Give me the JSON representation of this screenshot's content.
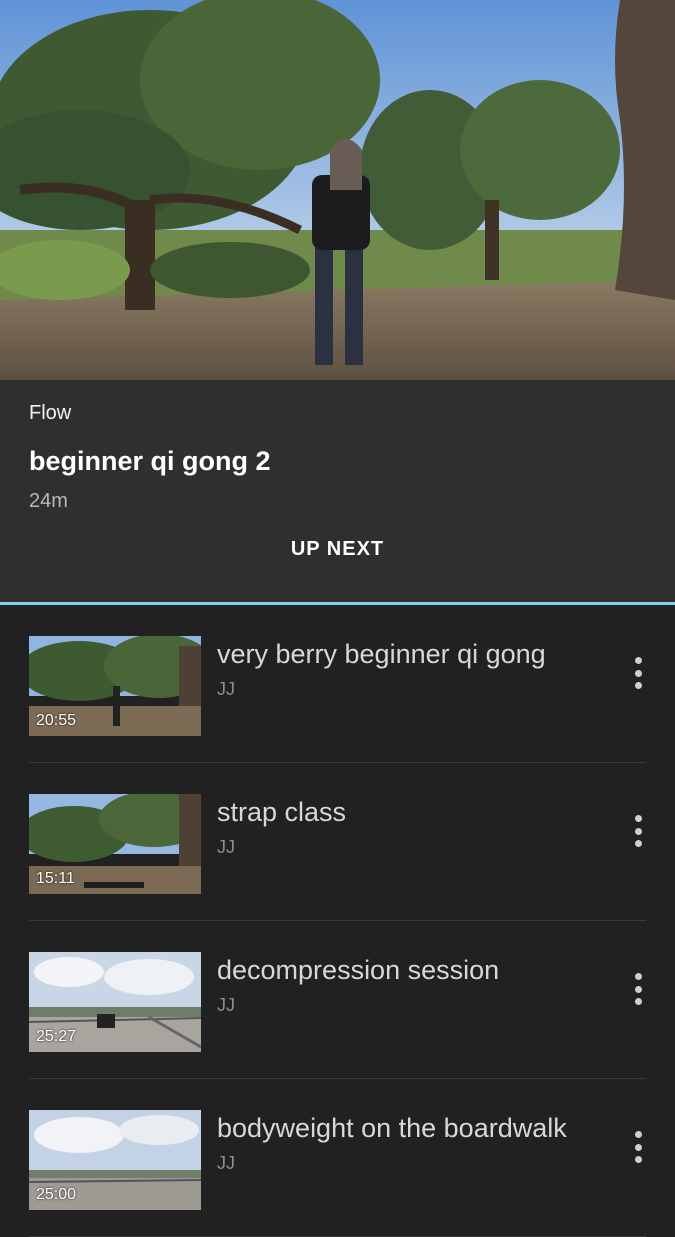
{
  "video": {
    "category": "Flow",
    "title": "beginner qi gong 2",
    "duration": "24m"
  },
  "tabs": {
    "up_next_label": "UP NEXT",
    "indicator_color": "#7fd3f0"
  },
  "up_next": [
    {
      "name": "very berry beginner qi gong",
      "author": "JJ",
      "time": "20:55",
      "scene": "park"
    },
    {
      "name": "strap class",
      "author": "JJ",
      "time": "15:11",
      "scene": "park-lying"
    },
    {
      "name": "decompression session",
      "author": "JJ",
      "time": "25:27",
      "scene": "boardwalk"
    },
    {
      "name": "bodyweight on the boardwalk",
      "author": "JJ",
      "time": "25:00",
      "scene": "boardwalk"
    }
  ],
  "icons": {
    "more": "more-vertical-icon"
  }
}
